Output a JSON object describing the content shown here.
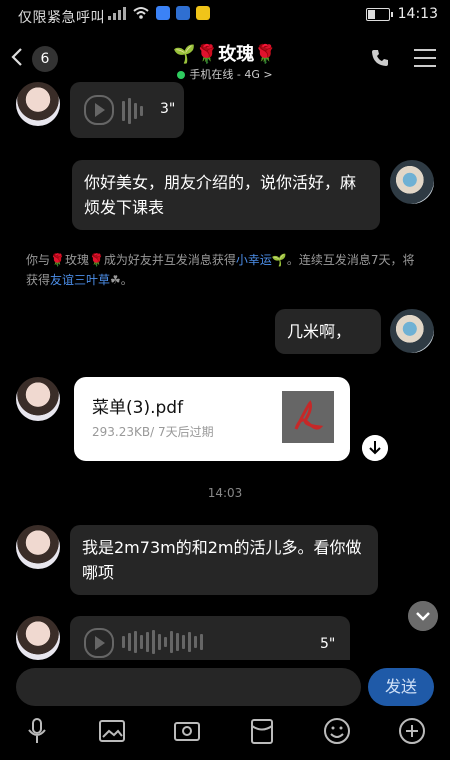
{
  "status_bar": {
    "left_text": "仅限紧急呼叫",
    "time": "14:13"
  },
  "header": {
    "unread_count": "6",
    "contact_name": "🌱🌹玫瑰🌹",
    "status": "手机在线 - 4G",
    "status_chevron": ">"
  },
  "messages": {
    "voice_1_duration": "3\"",
    "msg_1": "你好美女，朋友介绍的，说你活好，麻烦发下课表",
    "system_line_1": "你与🌹玫瑰🌹成为好友并互发消息获得",
    "system_link_1": "小幸运",
    "system_line_2": "🌱。连续互发消息7天，将获得",
    "system_link_2": "友谊三叶草",
    "system_line_3": "☘。",
    "msg_2": "几米啊，",
    "file_name": "菜单(3).pdf",
    "file_meta": "293.23KB/ 7天后过期",
    "timestamp": "14:03",
    "msg_3": "我是2m73m的和2m的活儿多。看你做哪项",
    "voice_2_duration": "5\""
  },
  "input": {
    "send_label": "发送"
  },
  "colors": {
    "accent": "#1f5aa8",
    "link": "#4c8ee8",
    "bubble": "#262626"
  }
}
